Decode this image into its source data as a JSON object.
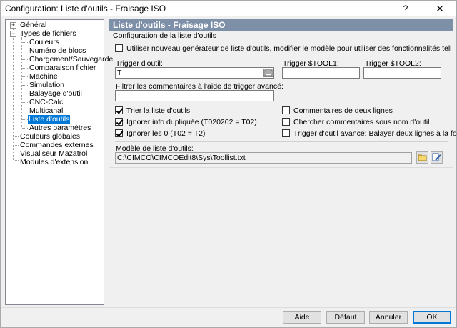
{
  "window": {
    "title": "Configuration: Liste d'outils - Fraisage ISO",
    "help_label": "?",
    "close_label": "✕"
  },
  "tree": {
    "items": [
      {
        "label": "Général",
        "expander": "+"
      },
      {
        "label": "Types de fichiers",
        "expander": "−"
      },
      {
        "label": "Couleurs"
      },
      {
        "label": "Numéro de blocs"
      },
      {
        "label": "Chargement/Sauvegarde"
      },
      {
        "label": "Comparaison fichier"
      },
      {
        "label": "Machine"
      },
      {
        "label": "Simulation"
      },
      {
        "label": "Balayage d'outil"
      },
      {
        "label": "CNC-Calc"
      },
      {
        "label": "Multicanal"
      },
      {
        "label": "Liste d'outils",
        "selected": true
      },
      {
        "label": "Autres paramètres"
      },
      {
        "label": "Couleurs globales"
      },
      {
        "label": "Commandes externes"
      },
      {
        "label": "Visualiseur Mazatrol"
      },
      {
        "label": "Modules d'extension"
      }
    ]
  },
  "panel": {
    "title": "Liste d'outils - Fraisage ISO",
    "group_label": "Configuration de la liste d'outils",
    "new_generator_label": "Utiliser nouveau générateur de liste d'outils, modifier le modèle pour utiliser des fonctionnalités telles que: Extraire texte, générer XML, ...",
    "trigger_label": "Trigger d'outil:",
    "trigger_value": "T",
    "tool1_label": "Trigger $TOOL1:",
    "tool1_value": "",
    "tool2_label": "Trigger $TOOL2:",
    "tool2_value": "",
    "filter_label": "Filtrer les commentaires à l'aide de trigger avancé:",
    "filter_value": "",
    "options_left": [
      {
        "label": "Trier la liste d'outils",
        "checked": true
      },
      {
        "label": "Ignorer info dupliquée (T020202 = T02)",
        "checked": true
      },
      {
        "label": "Ignorer les 0 (T02 = T2)",
        "checked": true
      }
    ],
    "options_right": [
      {
        "label": "Commentaires de deux lignes",
        "checked": false
      },
      {
        "label": "Chercher commentaires sous nom d'outil",
        "checked": false
      },
      {
        "label": "Trigger d'outil avancé: Balayer deux lignes à la fois",
        "checked": false
      }
    ],
    "template_label": "Modèle de liste d'outils:",
    "template_path": "C:\\CIMCO\\CIMCOEdit8\\Sys\\Toollist.txt"
  },
  "buttons": {
    "help": "Aide",
    "default": "Défaut",
    "cancel": "Annuler",
    "ok": "OK"
  },
  "colors": {
    "header_bg": "#7e8fa8",
    "selection": "#0078d7"
  }
}
